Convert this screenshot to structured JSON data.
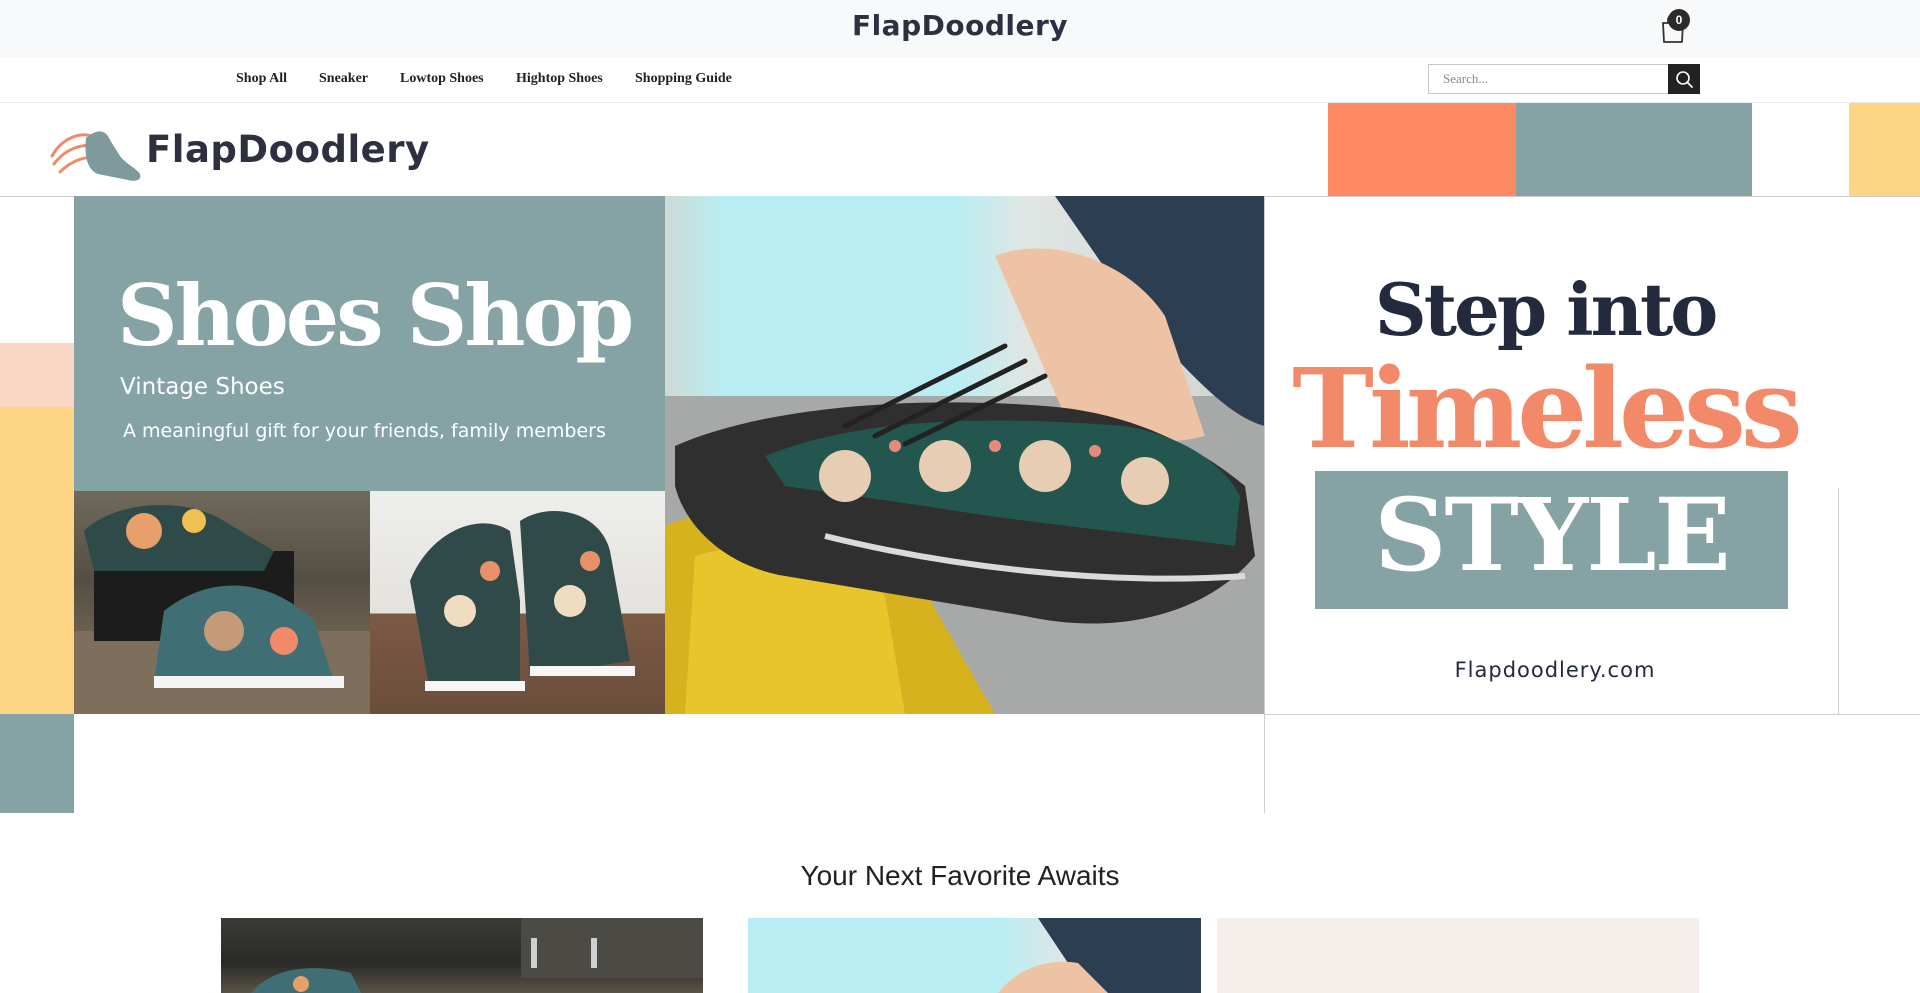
{
  "header": {
    "logo_text": "FlapDoodlery",
    "cart_count": "0"
  },
  "nav": {
    "items": [
      {
        "label": "Shop All"
      },
      {
        "label": "Sneaker"
      },
      {
        "label": "Lowtop Shoes"
      },
      {
        "label": "Hightop Shoes"
      },
      {
        "label": "Shopping Guide"
      }
    ],
    "search_placeholder": "Search..."
  },
  "hero": {
    "brand_text": "FlapDoodlery",
    "title": "Shoes Shop",
    "subtitle": "Vintage Shoes",
    "tagline": "A meaningful gift for your friends, family members",
    "headline_line1": "Step into",
    "headline_line2": "Timeless",
    "headline_line3": "STYLE",
    "site": "Flapdoodlery.com"
  },
  "section": {
    "title": "Your Next Favorite Awaits"
  },
  "colors": {
    "coral": "#f28a6a",
    "sage": "#85a2a4",
    "yellow": "#fed584",
    "navy": "#232a3d",
    "peach": "#f9d7c4"
  },
  "icons": [
    "shopping-bag-icon",
    "search-icon",
    "sneaker-logo-icon"
  ]
}
